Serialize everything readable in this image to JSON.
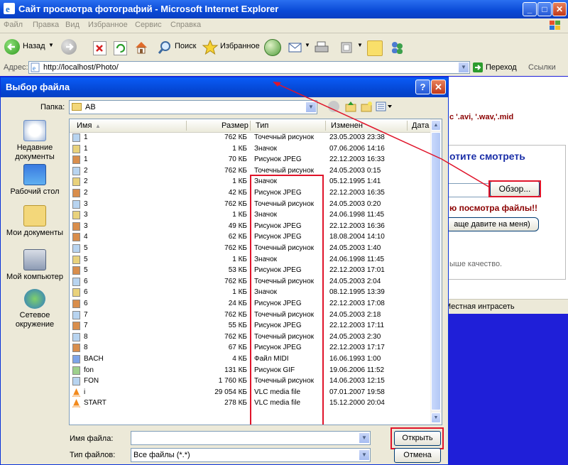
{
  "ie": {
    "title": "Сайт просмотра фотографий - Microsoft Internet Explorer",
    "menu": [
      "Файл",
      "Правка",
      "Вид",
      "Избранное",
      "Сервис",
      "Справка"
    ],
    "toolbar": {
      "back": "Назад",
      "search": "Поиск",
      "favorites": "Избранное"
    },
    "address": {
      "label": "Адрес:",
      "url": "http://localhost/Photo/",
      "go": "Переход",
      "links": "Ссылки"
    }
  },
  "page": {
    "formats": "с '.avi, '.wav,'.mid",
    "want_to_watch": "отите смотреть",
    "browse_button": "Обзор...",
    "files_notice": "ю посмотра файлы!!",
    "press_button": "аще давите на меня)",
    "quality_text": "ыше качество."
  },
  "status": {
    "zone": "Местная интрасеть"
  },
  "dialog": {
    "title": "Выбор файла",
    "folder_label": "Папка:",
    "folder_value": "AB",
    "places": [
      "Недавние документы",
      "Рабочий стол",
      "Мои документы",
      "Мой компьютер",
      "Сетевое окружение"
    ],
    "columns": {
      "name": "Имя",
      "size": "Размер",
      "type": "Тип",
      "modified": "Изменен",
      "date": "Дата"
    },
    "files": [
      {
        "name": "1",
        "size": "762 КБ",
        "type": "Точечный рисунок",
        "modified": "23.05.2003 23:38",
        "icon": "bmp"
      },
      {
        "name": "1",
        "size": "1 КБ",
        "type": "Значок",
        "modified": "07.06.2006 14:16",
        "icon": "ico"
      },
      {
        "name": "1",
        "size": "70 КБ",
        "type": "Рисунок JPEG",
        "modified": "22.12.2003 16:33",
        "icon": "jpg"
      },
      {
        "name": "2",
        "size": "762 КБ",
        "type": "Точечный рисунок",
        "modified": "24.05.2003 0:15",
        "icon": "bmp"
      },
      {
        "name": "2",
        "size": "1 КБ",
        "type": "Значок",
        "modified": "05.12.1995 1:41",
        "icon": "ico"
      },
      {
        "name": "2",
        "size": "42 КБ",
        "type": "Рисунок JPEG",
        "modified": "22.12.2003 16:35",
        "icon": "jpg"
      },
      {
        "name": "3",
        "size": "762 КБ",
        "type": "Точечный рисунок",
        "modified": "24.05.2003 0:20",
        "icon": "bmp"
      },
      {
        "name": "3",
        "size": "1 КБ",
        "type": "Значок",
        "modified": "24.06.1998 11:45",
        "icon": "ico"
      },
      {
        "name": "3",
        "size": "49 КБ",
        "type": "Рисунок JPEG",
        "modified": "22.12.2003 16:36",
        "icon": "jpg"
      },
      {
        "name": "4",
        "size": "62 КБ",
        "type": "Рисунок JPEG",
        "modified": "18.08.2004 14:10",
        "icon": "jpg"
      },
      {
        "name": "5",
        "size": "762 КБ",
        "type": "Точечный рисунок",
        "modified": "24.05.2003 1:40",
        "icon": "bmp"
      },
      {
        "name": "5",
        "size": "1 КБ",
        "type": "Значок",
        "modified": "24.06.1998 11:45",
        "icon": "ico"
      },
      {
        "name": "5",
        "size": "53 КБ",
        "type": "Рисунок JPEG",
        "modified": "22.12.2003 17:01",
        "icon": "jpg"
      },
      {
        "name": "6",
        "size": "762 КБ",
        "type": "Точечный рисунок",
        "modified": "24.05.2003 2:04",
        "icon": "bmp"
      },
      {
        "name": "6",
        "size": "1 КБ",
        "type": "Значок",
        "modified": "08.12.1995 13:39",
        "icon": "ico"
      },
      {
        "name": "6",
        "size": "24 КБ",
        "type": "Рисунок JPEG",
        "modified": "22.12.2003 17:08",
        "icon": "jpg"
      },
      {
        "name": "7",
        "size": "762 КБ",
        "type": "Точечный рисунок",
        "modified": "24.05.2003 2:18",
        "icon": "bmp"
      },
      {
        "name": "7",
        "size": "55 КБ",
        "type": "Рисунок JPEG",
        "modified": "22.12.2003 17:11",
        "icon": "jpg"
      },
      {
        "name": "8",
        "size": "762 КБ",
        "type": "Точечный рисунок",
        "modified": "24.05.2003 2:30",
        "icon": "bmp"
      },
      {
        "name": "8",
        "size": "67 КБ",
        "type": "Рисунок JPEG",
        "modified": "22.12.2003 17:17",
        "icon": "jpg"
      },
      {
        "name": "BACH",
        "size": "4 КБ",
        "type": "Файл MIDI",
        "modified": "16.06.1993 1:00",
        "icon": "midi"
      },
      {
        "name": "fon",
        "size": "131 КБ",
        "type": "Рисунок GIF",
        "modified": "19.06.2006 11:52",
        "icon": "gif"
      },
      {
        "name": "FON",
        "size": "1 760 КБ",
        "type": "Точечный рисунок",
        "modified": "14.06.2003 12:15",
        "icon": "bmp"
      },
      {
        "name": "i",
        "size": "29 054 КБ",
        "type": "VLC media file",
        "modified": "07.01.2007 19:58",
        "icon": "vlc"
      },
      {
        "name": "START",
        "size": "278 КБ",
        "type": "VLC media file",
        "modified": "15.12.2000 20:04",
        "icon": "vlc"
      }
    ],
    "filename_label": "Имя файла:",
    "filename_value": "",
    "filetype_label": "Тип файлов:",
    "filetype_value": "Все файлы (*.*)",
    "open_button": "Открыть",
    "cancel_button": "Отмена"
  },
  "colors": {
    "xp_blue": "#0a49d6",
    "annotation_red": "#e0142a",
    "desktop_blue": "#1f1fd8",
    "dark_red": "#8b0000",
    "link_blue": "#1b2fa8"
  }
}
